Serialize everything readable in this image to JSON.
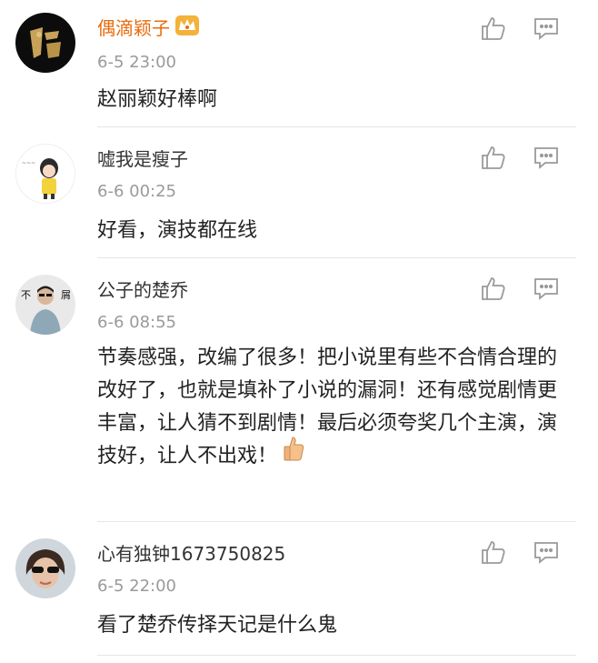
{
  "comments": [
    {
      "username": "偶滴颖子",
      "vip": true,
      "badge_icon": "crown-icon",
      "time": "6-5 23:00",
      "text": "赵丽颖好棒啊",
      "avatar": "dark-logo-avatar"
    },
    {
      "username": "嘘我是瘦子",
      "vip": false,
      "time": "6-6 00:25",
      "text": "好看，演技都在线",
      "avatar": "cartoon-girl-avatar"
    },
    {
      "username": "公子的楚乔",
      "vip": false,
      "time": "6-6 08:55",
      "text": "节奏感强，改编了很多！把小说里有些不合情合理的改好了，也就是填补了小说的漏洞！还有感觉剧情更丰富，让人猜不到剧情！最后必须夸奖几个主演，演技好，让人不出戏！",
      "emoji": "thumbs-up-icon",
      "avatar": "sunglasses-man-avatar"
    },
    {
      "username": "心有独钟1673750825",
      "vip": false,
      "time": "6-5 22:00",
      "text": "看了楚乔传择天记是什么鬼",
      "avatar": "sunglasses-woman-avatar"
    }
  ],
  "actions": {
    "like_icon": "thumbs-up-outline-icon",
    "reply_icon": "comment-bubble-icon"
  },
  "colors": {
    "vip_name": "#e86b0c",
    "time": "#9a9a9a",
    "icon": "#9a9a9a",
    "divider": "#e6e6e6"
  }
}
